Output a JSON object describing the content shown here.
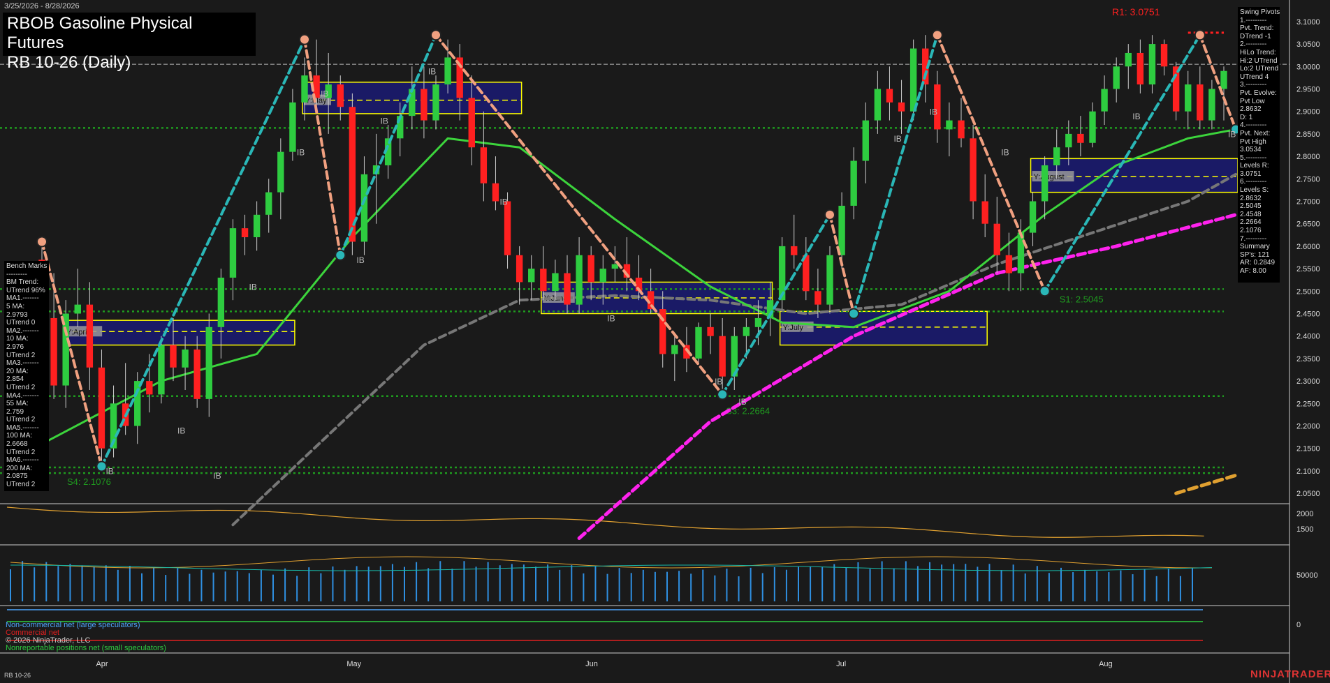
{
  "header": {
    "date_range": "3/25/2026 - 8/28/2026",
    "title_line1": "RBOB Gasoline Physical Futures",
    "title_line2": "RB 10-26 (Daily)"
  },
  "swing_pivots": [
    "Swing Pivots",
    "1.---------",
    "Pvt. Trend:",
    "DTrend -1",
    "2.---------",
    "HiLo Trend:",
    "Hi:2 UTrend",
    "Lo:2 UTrend",
    "UTrend 4",
    "3.---------",
    "Pvt. Evolve:",
    "Pvt Low",
    "2.8632",
    "D: 1",
    "4.---------",
    "Pvt. Next:",
    "Pvt High",
    "3.0534",
    "5.---------",
    "Levels R:",
    "3.0751",
    "6.---------",
    "Levels S:",
    "2.8632",
    "2.5045",
    "2.4548",
    "2.2664",
    "2.1076",
    "7.---------",
    "Summary",
    "SP's: 121",
    "AR: 0.2849",
    "AF: 8.00"
  ],
  "bench_marks": [
    "Bench Marks",
    "---------",
    "BM Trend:",
    "UTrend 96%",
    "MA1.-------",
    "5 MA:",
    "2.9793",
    "UTrend 0",
    "MA2.-------",
    "10 MA:",
    "2.976",
    "UTrend 2",
    "MA3.-------",
    "20 MA:",
    "2.854",
    "UTrend 2",
    "MA4.-------",
    "55 MA:",
    "2.759",
    "UTrend 2",
    "MA5.-------",
    "100 MA:",
    "2.6668",
    "UTrend 2",
    "MA6.-------",
    "200 MA:",
    "2.0875",
    "UTrend 2"
  ],
  "legend": {
    "noncommercial": "Non-commercial net (large speculators)",
    "commercial": "Commercial net",
    "copyright": "© 2026 NinjaTrader, LLC",
    "nonreportable": "Nonreportable positions net (small speculators)"
  },
  "footer": {
    "symbol": "RB 10-26",
    "brand": "NINJATRADER"
  },
  "colors": {
    "background": "#1a1a1a",
    "up_bar": "#2ecc40",
    "down_bar": "#ff2020",
    "ma20": "#3cd43c",
    "ma55": "#777777",
    "ma100": "#ff22ee",
    "ma200": "#e0a030",
    "swing_up": "#2ab7b7",
    "swing_down": "#f0a080",
    "resistance": "#ff2020",
    "support": "#1f9a1f",
    "box_fill": "#1a1a66",
    "box_border": "#ffff00"
  },
  "chart_data": {
    "type": "candlestick",
    "y_axis_ticks": [
      "3.1000",
      "3.0500",
      "3.0000",
      "2.9500",
      "2.9000",
      "2.8500",
      "2.8000",
      "2.7500",
      "2.7000",
      "2.6500",
      "2.6000",
      "2.5500",
      "2.5000",
      "2.4500",
      "2.4000",
      "2.3500",
      "2.3000",
      "2.2500",
      "2.2000",
      "2.1500",
      "2.1000",
      "2.0500"
    ],
    "ylim": [
      2.03,
      3.12
    ],
    "x_axis_labels": [
      {
        "label": "Apr",
        "index": 5
      },
      {
        "label": "May",
        "index": 26
      },
      {
        "label": "Jun",
        "index": 46
      },
      {
        "label": "Jul",
        "index": 67
      },
      {
        "label": "Aug",
        "index": 89
      }
    ],
    "bars": [
      [
        2.57,
        2.62,
        2.41,
        2.44
      ],
      [
        2.44,
        2.54,
        2.26,
        2.29
      ],
      [
        2.29,
        2.48,
        2.24,
        2.45
      ],
      [
        2.45,
        2.55,
        2.42,
        2.47
      ],
      [
        2.47,
        2.52,
        2.28,
        2.33
      ],
      [
        2.33,
        2.37,
        2.1,
        2.15
      ],
      [
        2.15,
        2.29,
        2.13,
        2.25
      ],
      [
        2.25,
        2.34,
        2.18,
        2.2
      ],
      [
        2.2,
        2.32,
        2.16,
        2.3
      ],
      [
        2.3,
        2.36,
        2.23,
        2.27
      ],
      [
        2.27,
        2.4,
        2.25,
        2.38
      ],
      [
        2.38,
        2.44,
        2.3,
        2.33
      ],
      [
        2.33,
        2.4,
        2.28,
        2.37
      ],
      [
        2.37,
        2.4,
        2.24,
        2.26
      ],
      [
        2.26,
        2.45,
        2.22,
        2.42
      ],
      [
        2.42,
        2.55,
        2.35,
        2.53
      ],
      [
        2.53,
        2.66,
        2.48,
        2.64
      ],
      [
        2.64,
        2.67,
        2.58,
        2.62
      ],
      [
        2.62,
        2.7,
        2.59,
        2.67
      ],
      [
        2.67,
        2.75,
        2.63,
        2.72
      ],
      [
        2.72,
        2.84,
        2.66,
        2.81
      ],
      [
        2.81,
        2.95,
        2.79,
        2.92
      ],
      [
        2.92,
        3.02,
        2.88,
        2.98
      ],
      [
        2.98,
        3.06,
        2.9,
        2.93
      ],
      [
        2.93,
        3.03,
        2.85,
        2.96
      ],
      [
        2.96,
        2.98,
        2.88,
        2.91
      ],
      [
        2.91,
        2.94,
        2.58,
        2.61
      ],
      [
        2.61,
        2.8,
        2.58,
        2.76
      ],
      [
        2.76,
        2.85,
        2.65,
        2.78
      ],
      [
        2.78,
        2.87,
        2.75,
        2.84
      ],
      [
        2.84,
        2.92,
        2.8,
        2.89
      ],
      [
        2.89,
        3.0,
        2.86,
        2.95
      ],
      [
        2.95,
        3.0,
        2.84,
        2.88
      ],
      [
        2.88,
        2.98,
        2.86,
        2.96
      ],
      [
        2.96,
        3.06,
        2.94,
        3.02
      ],
      [
        3.02,
        3.05,
        2.88,
        2.93
      ],
      [
        2.93,
        2.98,
        2.78,
        2.82
      ],
      [
        2.82,
        2.9,
        2.7,
        2.74
      ],
      [
        2.74,
        2.8,
        2.68,
        2.7
      ],
      [
        2.7,
        2.72,
        2.55,
        2.58
      ],
      [
        2.58,
        2.6,
        2.47,
        2.52
      ],
      [
        2.52,
        2.58,
        2.48,
        2.55
      ],
      [
        2.55,
        2.6,
        2.48,
        2.5
      ],
      [
        2.5,
        2.57,
        2.48,
        2.54
      ],
      [
        2.54,
        2.58,
        2.45,
        2.47
      ],
      [
        2.47,
        2.62,
        2.45,
        2.58
      ],
      [
        2.58,
        2.6,
        2.48,
        2.52
      ],
      [
        2.52,
        2.58,
        2.47,
        2.55
      ],
      [
        2.55,
        2.6,
        2.52,
        2.56
      ],
      [
        2.56,
        2.62,
        2.5,
        2.53
      ],
      [
        2.53,
        2.58,
        2.48,
        2.5
      ],
      [
        2.5,
        2.55,
        2.45,
        2.46
      ],
      [
        2.46,
        2.5,
        2.33,
        2.36
      ],
      [
        2.36,
        2.4,
        2.3,
        2.38
      ],
      [
        2.38,
        2.42,
        2.32,
        2.35
      ],
      [
        2.35,
        2.43,
        2.34,
        2.42
      ],
      [
        2.42,
        2.45,
        2.36,
        2.4
      ],
      [
        2.4,
        2.44,
        2.28,
        2.31
      ],
      [
        2.31,
        2.42,
        2.28,
        2.4
      ],
      [
        2.4,
        2.44,
        2.35,
        2.42
      ],
      [
        2.42,
        2.48,
        2.38,
        2.44
      ],
      [
        2.44,
        2.52,
        2.4,
        2.48
      ],
      [
        2.48,
        2.62,
        2.46,
        2.6
      ],
      [
        2.6,
        2.67,
        2.55,
        2.58
      ],
      [
        2.58,
        2.62,
        2.48,
        2.5
      ],
      [
        2.5,
        2.55,
        2.44,
        2.47
      ],
      [
        2.47,
        2.6,
        2.45,
        2.58
      ],
      [
        2.58,
        2.72,
        2.55,
        2.69
      ],
      [
        2.69,
        2.82,
        2.66,
        2.79
      ],
      [
        2.79,
        2.92,
        2.74,
        2.88
      ],
      [
        2.88,
        2.99,
        2.85,
        2.95
      ],
      [
        2.95,
        3.0,
        2.88,
        2.92
      ],
      [
        2.92,
        2.97,
        2.85,
        2.9
      ],
      [
        2.9,
        3.06,
        2.88,
        3.04
      ],
      [
        3.04,
        3.07,
        2.92,
        2.96
      ],
      [
        2.96,
        2.99,
        2.83,
        2.86
      ],
      [
        2.86,
        2.92,
        2.8,
        2.88
      ],
      [
        2.88,
        2.93,
        2.82,
        2.84
      ],
      [
        2.84,
        2.87,
        2.66,
        2.7
      ],
      [
        2.7,
        2.76,
        2.62,
        2.65
      ],
      [
        2.65,
        2.71,
        2.54,
        2.58
      ],
      [
        2.58,
        2.63,
        2.5,
        2.54
      ],
      [
        2.54,
        2.66,
        2.5,
        2.63
      ],
      [
        2.63,
        2.72,
        2.6,
        2.7
      ],
      [
        2.7,
        2.8,
        2.66,
        2.78
      ],
      [
        2.78,
        2.86,
        2.75,
        2.82
      ],
      [
        2.82,
        2.88,
        2.78,
        2.85
      ],
      [
        2.85,
        2.89,
        2.8,
        2.83
      ],
      [
        2.83,
        2.92,
        2.82,
        2.9
      ],
      [
        2.9,
        2.98,
        2.87,
        2.95
      ],
      [
        2.95,
        3.02,
        2.92,
        3.0
      ],
      [
        3.0,
        3.05,
        2.95,
        3.03
      ],
      [
        3.03,
        3.06,
        2.94,
        2.96
      ],
      [
        2.96,
        3.07,
        2.94,
        3.05
      ],
      [
        3.05,
        3.06,
        2.98,
        3.0
      ],
      [
        3.0,
        3.01,
        2.88,
        2.9
      ],
      [
        2.9,
        2.99,
        2.86,
        2.96
      ],
      [
        2.96,
        3.0,
        2.86,
        2.88
      ],
      [
        2.88,
        2.97,
        2.86,
        2.95
      ],
      [
        2.95,
        3.0,
        2.88,
        2.99
      ]
    ],
    "bar_dates_note": "",
    "moving_averages": {
      "ma20": [
        [
          0,
          2.16
        ],
        [
          10,
          2.3
        ],
        [
          18,
          2.36
        ],
        [
          26,
          2.62
        ],
        [
          34,
          2.84
        ],
        [
          40,
          2.82
        ],
        [
          48,
          2.66
        ],
        [
          56,
          2.51
        ],
        [
          62,
          2.43
        ],
        [
          68,
          2.42
        ],
        [
          76,
          2.5
        ],
        [
          84,
          2.67
        ],
        [
          90,
          2.78
        ],
        [
          96,
          2.84
        ],
        [
          100,
          2.86
        ]
      ],
      "ma55": [
        [
          16,
          1.98
        ],
        [
          24,
          2.18
        ],
        [
          32,
          2.38
        ],
        [
          40,
          2.48
        ],
        [
          48,
          2.49
        ],
        [
          56,
          2.48
        ],
        [
          64,
          2.45
        ],
        [
          72,
          2.47
        ],
        [
          80,
          2.56
        ],
        [
          88,
          2.63
        ],
        [
          96,
          2.7
        ],
        [
          100,
          2.76
        ]
      ],
      "ma100": [
        [
          45,
          1.95
        ],
        [
          56,
          2.21
        ],
        [
          68,
          2.4
        ],
        [
          80,
          2.54
        ],
        [
          90,
          2.6
        ],
        [
          100,
          2.67
        ]
      ],
      "ma200": [
        [
          95,
          2.05
        ],
        [
          100,
          2.09
        ]
      ]
    },
    "swing_legs": [
      {
        "from": [
          0,
          2.61
        ],
        "to": [
          5,
          2.11
        ],
        "dir": "down"
      },
      {
        "from": [
          5,
          2.11
        ],
        "to": [
          22,
          3.06
        ],
        "dir": "up"
      },
      {
        "from": [
          22,
          3.06
        ],
        "to": [
          25,
          2.58
        ],
        "dir": "down"
      },
      {
        "from": [
          25,
          2.58
        ],
        "to": [
          33,
          3.07
        ],
        "dir": "up"
      },
      {
        "from": [
          33,
          3.07
        ],
        "to": [
          57,
          2.27
        ],
        "dir": "down"
      },
      {
        "from": [
          57,
          2.27
        ],
        "to": [
          66,
          2.67
        ],
        "dir": "up"
      },
      {
        "from": [
          66,
          2.67
        ],
        "to": [
          68,
          2.45
        ],
        "dir": "down"
      },
      {
        "from": [
          68,
          2.45
        ],
        "to": [
          75,
          3.07
        ],
        "dir": "up"
      },
      {
        "from": [
          75,
          3.07
        ],
        "to": [
          84,
          2.5
        ],
        "dir": "down"
      },
      {
        "from": [
          84,
          2.5
        ],
        "to": [
          97,
          3.07
        ],
        "dir": "up"
      },
      {
        "from": [
          97,
          3.07
        ],
        "to": [
          100,
          2.86
        ],
        "dir": "down"
      }
    ],
    "pivot_highs": [
      [
        0,
        2.61
      ],
      [
        22,
        3.06
      ],
      [
        33,
        3.07
      ],
      [
        66,
        2.67
      ],
      [
        75,
        3.07
      ],
      [
        97,
        3.07
      ]
    ],
    "pivot_lows": [
      [
        5,
        2.11
      ],
      [
        25,
        2.58
      ],
      [
        57,
        2.27
      ],
      [
        68,
        2.45
      ],
      [
        84,
        2.5
      ],
      [
        100,
        2.86
      ]
    ],
    "support_levels": [
      {
        "value": 2.8632,
        "label": ""
      },
      {
        "value": 2.5045,
        "label": "S1: 2.5045"
      },
      {
        "value": 2.4548,
        "label": ""
      },
      {
        "value": 2.2664,
        "label": "S3: 2.2664"
      },
      {
        "value": 2.1076,
        "label": "S4: 2.1076"
      },
      {
        "value": 2.095,
        "label": ""
      }
    ],
    "resistance_levels": [
      {
        "value": 3.0751,
        "label": "R1: 3.0751"
      }
    ],
    "current_price_line": 3.005,
    "monthly_boxes": [
      {
        "label": "Y:April",
        "start": 2,
        "end": 21,
        "high": 2.435,
        "low": 2.38,
        "mid": 2.41
      },
      {
        "label": "Y:May",
        "start": 22,
        "end": 40,
        "high": 2.965,
        "low": 2.895,
        "mid": 2.925
      },
      {
        "label": "Y:June",
        "start": 42,
        "end": 61,
        "high": 2.52,
        "low": 2.45,
        "mid": 2.485
      },
      {
        "label": "Y:July",
        "start": 62,
        "end": 79,
        "high": 2.455,
        "low": 2.38,
        "mid": 2.42
      },
      {
        "label": "Y:August",
        "start": 83,
        "end": 100,
        "high": 2.795,
        "low": 2.72,
        "mid": 2.755
      }
    ],
    "ib_labels": [
      [
        5,
        2.105
      ],
      [
        11,
        2.195
      ],
      [
        14,
        2.095
      ],
      [
        17,
        2.515
      ],
      [
        21,
        2.815
      ],
      [
        23,
        2.945
      ],
      [
        26,
        2.575
      ],
      [
        28,
        2.885
      ],
      [
        32,
        2.995
      ],
      [
        38,
        2.705
      ],
      [
        47,
        2.445
      ],
      [
        56,
        2.305
      ],
      [
        58,
        2.26
      ],
      [
        71,
        2.845
      ],
      [
        74,
        2.905
      ],
      [
        80,
        2.815
      ],
      [
        91,
        2.895
      ],
      [
        99,
        2.855
      ]
    ],
    "volume_panel": {
      "ticks": [
        "2000",
        "1500"
      ],
      "ylim": [
        1100,
        2200
      ]
    },
    "oi_panel": {
      "ticks": [
        "50000"
      ]
    },
    "cot_panel": {
      "ticks": [
        "0"
      ]
    }
  }
}
